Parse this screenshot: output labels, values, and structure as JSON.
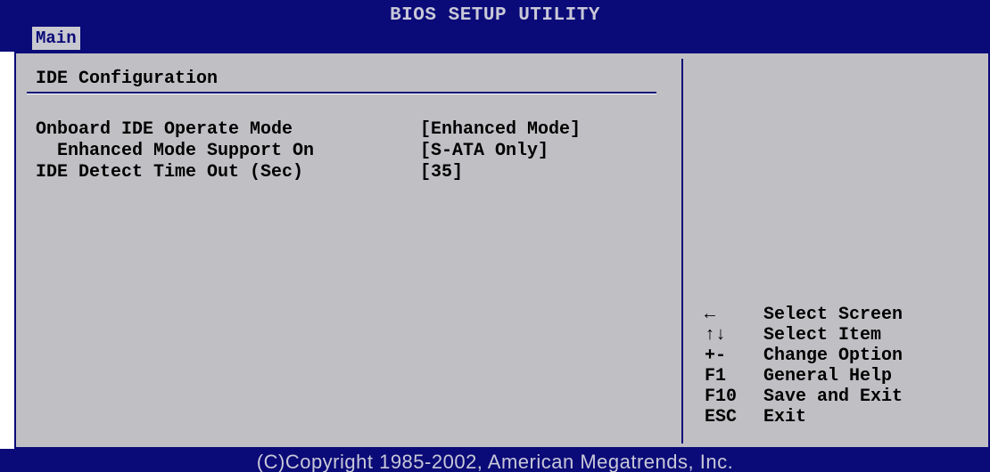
{
  "header": {
    "title": "BIOS SETUP UTILITY",
    "tabs": [
      {
        "label": "Main",
        "active": true
      }
    ]
  },
  "main": {
    "section_title": "IDE Configuration",
    "settings": [
      {
        "label": "Onboard IDE Operate Mode",
        "value": "[Enhanced Mode]"
      },
      {
        "label": "  Enhanced Mode Support On",
        "value": "[S-ATA Only]"
      },
      {
        "label": "IDE Detect Time Out (Sec)",
        "value": "[35]"
      }
    ]
  },
  "help": {
    "items": [
      {
        "key": "←",
        "key_icon": "arrow-left-icon",
        "description": "Select Screen"
      },
      {
        "key": "↑↓",
        "key_icon": "arrow-up-down-icon",
        "description": "Select Item"
      },
      {
        "key": "+-",
        "description": "Change Option"
      },
      {
        "key": "F1",
        "description": "General Help"
      },
      {
        "key": "F10",
        "description": "Save and Exit"
      },
      {
        "key": "ESC",
        "description": "Exit"
      }
    ]
  },
  "footer": {
    "copyright": "(C)Copyright 1985-2002, American Megatrends, Inc."
  },
  "colors": {
    "bar_background": "#0a0a78",
    "panel_background": "#c0c0c4",
    "bar_text": "#c8c8d8"
  }
}
